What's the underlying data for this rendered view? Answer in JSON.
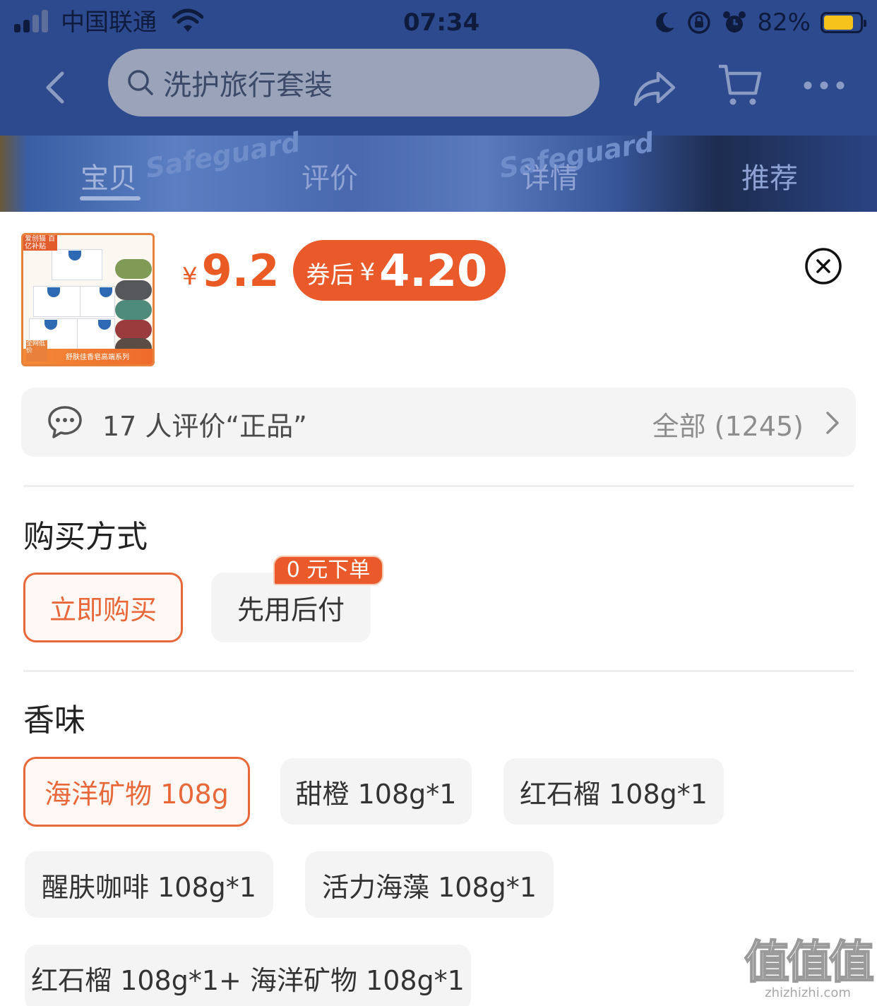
{
  "status_bar": {
    "carrier": "中国联通",
    "time": "07:34",
    "battery_percent": "82%",
    "battery_level": 0.82
  },
  "nav": {
    "search_placeholder": "洗护旅行套装",
    "icons": [
      "chevron-left-icon",
      "search-icon",
      "share-icon",
      "cart-icon",
      "more-icon"
    ]
  },
  "banner": {
    "brand_deco": "Safeguard"
  },
  "tabs": [
    {
      "label": "宝贝",
      "active": true
    },
    {
      "label": "评价",
      "active": false
    },
    {
      "label": "详情",
      "active": false
    },
    {
      "label": "推荐",
      "active": false
    }
  ],
  "product": {
    "thumb_tag": "爱创猫 百亿补贴",
    "thumb_footer": "舒肤佳香皂高端系列",
    "thumb_badge": "全网低价",
    "currency": "¥",
    "price": "9.2",
    "coupon_label": "券后",
    "coupon_currency": "¥",
    "coupon_price": "4.20"
  },
  "reviews": {
    "summary": "17 人评价“正品”",
    "all_label": "全部 (1245)"
  },
  "purchase": {
    "title": "购买方式",
    "options": [
      {
        "label": "立即购买",
        "selected": true
      },
      {
        "label": "先用后付",
        "selected": false
      }
    ],
    "badge": "0 元下单"
  },
  "scent": {
    "title": "香味",
    "options": [
      {
        "label": "海洋矿物 108g",
        "selected": true
      },
      {
        "label": "甜橙 108g*1",
        "selected": false
      },
      {
        "label": "红石榴 108g*1",
        "selected": false
      },
      {
        "label": "醒肤咖啡 108g*1",
        "selected": false
      },
      {
        "label": "活力海藻 108g*1",
        "selected": false
      },
      {
        "label": "红石榴 108g*1+ 海洋矿物 108g*1",
        "selected": false
      }
    ]
  },
  "watermark": {
    "logo": "值值值",
    "url": "zhizhizhi.com"
  },
  "colors": {
    "accent": "#e9592a",
    "nav_bg": "#2d4a8e",
    "option_bg": "#f4f4f4"
  }
}
